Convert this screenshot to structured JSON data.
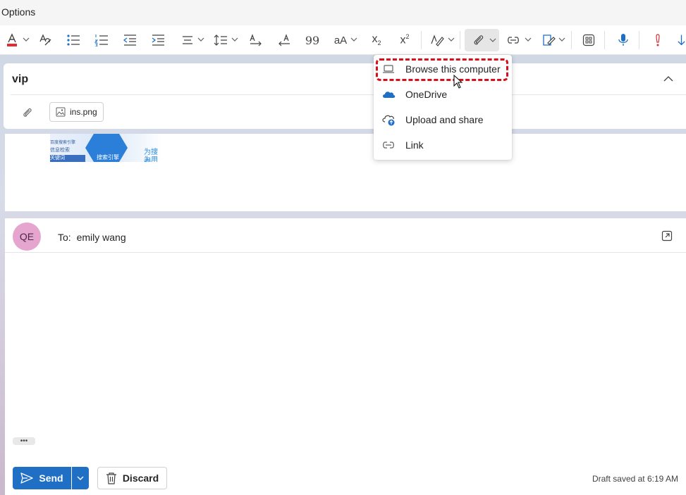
{
  "topbar": {
    "tab_label": "Options"
  },
  "toolbar": {
    "buttons": [
      "font-color",
      "spelling",
      "bullets",
      "numbering",
      "decrease-indent",
      "increase-indent",
      "align",
      "line-spacing",
      "ltr",
      "rtl",
      "quote",
      "change-case",
      "subscript",
      "superscript",
      "styles",
      "attach-file",
      "link",
      "signature",
      "apps",
      "dictate",
      "importance"
    ],
    "subscript_label": "x",
    "subscript_sub": "2",
    "superscript_label": "x",
    "superscript_sup": "2",
    "case_label": "aA",
    "quote_label": "99",
    "font_color_accent": "#d13438",
    "accent": "#1f6fc5"
  },
  "subject": {
    "value": "vip"
  },
  "attachment": {
    "file_name": "ins.png"
  },
  "preview": {
    "thumb_title": "百度搜索引擎",
    "thumb_line1": "信息检索",
    "thumb_line2": "关键词",
    "thumb_center": "搜索引擎",
    "thumb_right1": "为搜索",
    "thumb_right2": "为用户"
  },
  "attach_menu": {
    "items": [
      {
        "label": "Browse this computer",
        "icon": "laptop-icon"
      },
      {
        "label": "OneDrive",
        "icon": "onedrive-cloud-icon"
      },
      {
        "label": "Upload and share",
        "icon": "cloud-upload-icon"
      },
      {
        "label": "Link",
        "icon": "link-icon"
      }
    ]
  },
  "compose": {
    "avatar_initials": "QE",
    "to_label": "To:",
    "recipient": "emily wang",
    "more_label": "•••",
    "send_label": "Send",
    "discard_label": "Discard",
    "draft_status": "Draft saved at 6:19 AM"
  },
  "colors": {
    "highlight": "#d90e1a",
    "avatar_bg": "#e6a5cf",
    "send_bg": "#1f6fc5"
  }
}
